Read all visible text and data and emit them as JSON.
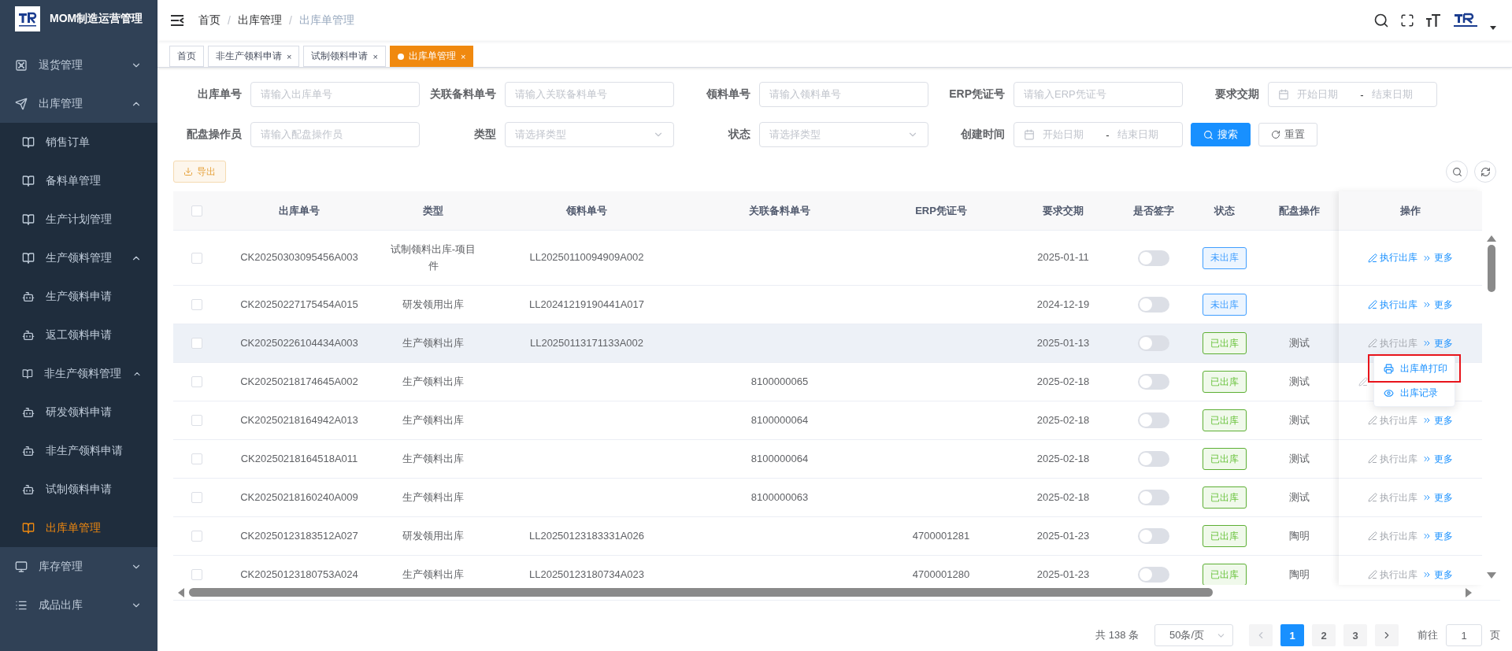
{
  "app": {
    "title": "MOM制造运营管理"
  },
  "sidebar": {
    "items": [
      {
        "label": "退货管理",
        "kind": "safe",
        "expanded": false,
        "selected": false
      },
      {
        "label": "出库管理",
        "kind": "plane",
        "expanded": true,
        "selected": false,
        "children": [
          {
            "label": "销售订单",
            "kind": "book",
            "selected": false
          },
          {
            "label": "备料单管理",
            "kind": "book",
            "selected": false
          },
          {
            "label": "生产计划管理",
            "kind": "book",
            "selected": false
          },
          {
            "label": "生产领料管理",
            "kind": "book",
            "expanded": true,
            "selected": false,
            "children": [
              {
                "label": "生产领料申请",
                "kind": "bot",
                "selected": false
              },
              {
                "label": "返工领料申请",
                "kind": "bot",
                "selected": false
              }
            ]
          },
          {
            "label": "非生产领料管理",
            "kind": "book",
            "expanded": true,
            "selected": false,
            "children": [
              {
                "label": "研发领料申请",
                "kind": "bot",
                "selected": false
              },
              {
                "label": "非生产领料申请",
                "kind": "bot",
                "selected": false
              },
              {
                "label": "试制领料申请",
                "kind": "bot",
                "selected": false
              }
            ]
          },
          {
            "label": "出库单管理",
            "kind": "book",
            "selected": true
          }
        ]
      },
      {
        "label": "库存管理",
        "kind": "monitor",
        "expanded": false,
        "selected": false
      },
      {
        "label": "成品出库",
        "kind": "list",
        "expanded": false,
        "selected": false
      }
    ]
  },
  "breadcrumb": {
    "separator": "/",
    "items": [
      "首页",
      "出库管理",
      "出库单管理"
    ]
  },
  "tabs": [
    {
      "label": "首页",
      "selected": false
    },
    {
      "label": "非生产领料申请",
      "close": "×",
      "selected": false
    },
    {
      "label": "试制领料申请",
      "close": "×",
      "selected": false
    },
    {
      "label": "出库单管理",
      "close": "×",
      "selected": true
    }
  ],
  "filters": [
    {
      "label": "出库单号",
      "kind": "input",
      "placeholder": "请输入出库单号"
    },
    {
      "label": "关联备料单号",
      "kind": "input",
      "placeholder": "请输入关联备料单号"
    },
    {
      "label": "领料单号",
      "kind": "input",
      "placeholder": "请输入领料单号"
    },
    {
      "label": "ERP凭证号",
      "kind": "input",
      "placeholder": "请输入ERP凭证号"
    },
    {
      "label": "要求交期",
      "kind": "daterange",
      "start": "开始日期",
      "separator": "-",
      "end": "结束日期"
    },
    {
      "label": "配盘操作员",
      "kind": "input",
      "placeholder": "请输入配盘操作员"
    },
    {
      "label": "类型",
      "kind": "select",
      "placeholder": "请选择类型"
    },
    {
      "label": "状态",
      "kind": "select",
      "placeholder": "请选择类型"
    },
    {
      "label": "创建时间",
      "kind": "daterange",
      "start": "开始日期",
      "separator": "-",
      "end": "结束日期"
    }
  ],
  "search_button": "搜索",
  "reset_button": "重置",
  "export_button": "导出",
  "table": {
    "columns": [
      "出库单号",
      "类型",
      "领料单号",
      "关联备料单号",
      "ERP凭证号",
      "要求交期",
      "是否签字",
      "状态",
      "配盘操作",
      "操作"
    ],
    "header_checked": false,
    "rows": [
      {
        "checked": false,
        "hovered": false,
        "outbound_no": "CK20250303095456A003",
        "type": "试制领料出库-项目件",
        "picking_no": "LL20250110094909A002",
        "due_date": "2025-01-11",
        "signed": false,
        "status": {
          "label": "未出库",
          "kind": "pending"
        },
        "execute": {
          "label": "执行出库",
          "disabled": false
        },
        "more": "更多"
      },
      {
        "checked": false,
        "hovered": false,
        "outbound_no": "CK20250227175454A015",
        "type": "研发领用出库",
        "picking_no": "LL20241219190441A017",
        "due_date": "2024-12-19",
        "signed": false,
        "status": {
          "label": "未出库",
          "kind": "pending"
        },
        "execute": {
          "label": "执行出库",
          "disabled": false
        },
        "more": "更多"
      },
      {
        "checked": false,
        "hovered": true,
        "outbound_no": "CK20250226104434A003",
        "type": "生产领料出库",
        "picking_no": "LL20250113171133A002",
        "due_date": "2025-01-13",
        "signed": false,
        "status": {
          "label": "已出库",
          "kind": "done"
        },
        "operator": "测试",
        "execute": {
          "label": "执行出库",
          "disabled": true
        },
        "more": "更多"
      },
      {
        "checked": false,
        "hovered": false,
        "outbound_no": "CK20250218174645A002",
        "type": "生产领料出库",
        "related_no": "8100000065",
        "due_date": "2025-02-18",
        "signed": false,
        "status": {
          "label": "已出库",
          "kind": "done"
        },
        "operator": "测试"
      },
      {
        "checked": false,
        "hovered": false,
        "outbound_no": "CK20250218164942A013",
        "type": "生产领料出库",
        "related_no": "8100000064",
        "due_date": "2025-02-18",
        "signed": false,
        "status": {
          "label": "已出库",
          "kind": "done"
        },
        "operator": "测试",
        "execute": {
          "label": "执行出库",
          "disabled": true
        },
        "more": "更多"
      },
      {
        "checked": false,
        "hovered": false,
        "outbound_no": "CK20250218164518A011",
        "type": "生产领料出库",
        "related_no": "8100000064",
        "due_date": "2025-02-18",
        "signed": false,
        "status": {
          "label": "已出库",
          "kind": "done"
        },
        "operator": "测试",
        "execute": {
          "label": "执行出库",
          "disabled": true
        },
        "more": "更多"
      },
      {
        "checked": false,
        "hovered": false,
        "outbound_no": "CK20250218160240A009",
        "type": "生产领料出库",
        "related_no": "8100000063",
        "due_date": "2025-02-18",
        "signed": false,
        "status": {
          "label": "已出库",
          "kind": "done"
        },
        "operator": "测试",
        "execute": {
          "label": "执行出库",
          "disabled": true
        },
        "more": "更多"
      },
      {
        "checked": false,
        "hovered": false,
        "outbound_no": "CK20250123183512A027",
        "type": "研发领用出库",
        "picking_no": "LL20250123183331A026",
        "erp_no": "4700001281",
        "due_date": "2025-01-23",
        "signed": false,
        "status": {
          "label": "已出库",
          "kind": "done"
        },
        "operator": "陶明",
        "execute": {
          "label": "执行出库",
          "disabled": true
        },
        "more": "更多"
      },
      {
        "checked": false,
        "hovered": false,
        "outbound_no": "CK20250123180753A024",
        "type": "生产领料出库",
        "picking_no": "LL20250123180734A023",
        "erp_no": "4700001280",
        "due_date": "2025-01-23",
        "signed": false,
        "status": {
          "label": "已出库",
          "kind": "done"
        },
        "operator": "陶明",
        "execute": {
          "label": "执行出库",
          "disabled": true
        },
        "more": "更多"
      }
    ]
  },
  "more_menu": {
    "items": [
      {
        "label": "出库单打印",
        "kind": "print",
        "marked": true
      },
      {
        "label": "出库记录",
        "kind": "view",
        "marked": false
      }
    ]
  },
  "pagination": {
    "total": "共 138 条",
    "page_size": "50条/页",
    "pages": [
      {
        "label": "1",
        "selected": true
      },
      {
        "label": "2",
        "selected": false
      },
      {
        "label": "3",
        "selected": false
      }
    ],
    "goto_label": "前往",
    "goto_value": "1",
    "goto_unit": "页"
  }
}
